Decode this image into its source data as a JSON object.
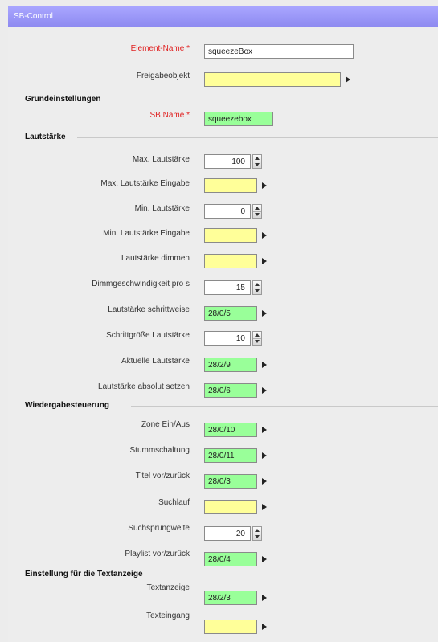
{
  "window": {
    "title": "SB-Control"
  },
  "general": {
    "element_name": {
      "label": "Element-Name",
      "required_mark": "*",
      "value": "squeezeBox"
    },
    "freigabeobjekt": {
      "label": "Freigabeobjekt",
      "value": ""
    }
  },
  "grundeinstellungen": {
    "title": "Grundeinstellungen",
    "sb_name": {
      "label": "SB Name",
      "required_mark": "*",
      "value": "squeezebox"
    }
  },
  "lautstaerke": {
    "title": "Lautstärke",
    "max": {
      "label": "Max. Lautstärke",
      "value": "100"
    },
    "max_input": {
      "label": "Max. Lautstärke Eingabe",
      "value": ""
    },
    "min": {
      "label": "Min. Lautstärke",
      "value": "0"
    },
    "min_input": {
      "label": "Min. Lautstärke Eingabe",
      "value": ""
    },
    "dimmen": {
      "label": "Lautstärke dimmen",
      "value": ""
    },
    "dimm_speed": {
      "label": "Dimmgeschwindigkeit pro s",
      "value": "15"
    },
    "schrittweise": {
      "label": "Lautstärke schrittweise",
      "value": "28/0/5"
    },
    "schrittgroesse": {
      "label": "Schrittgröße Lautstärke",
      "value": "10"
    },
    "aktuell": {
      "label": "Aktuelle Lautstärke",
      "value": "28/2/9"
    },
    "absolut": {
      "label": "Lautstärke absolut setzen",
      "value": "28/0/6"
    }
  },
  "wiedergabe": {
    "title": "Wiedergabesteuerung",
    "zone": {
      "label": "Zone Ein/Aus",
      "value": "28/0/10"
    },
    "stumm": {
      "label": "Stummschaltung",
      "value": "28/0/11"
    },
    "titel": {
      "label": "Titel vor/zurück",
      "value": "28/0/3"
    },
    "suchlauf": {
      "label": "Suchlauf",
      "value": ""
    },
    "suchsprung": {
      "label": "Suchsprungweite",
      "value": "20"
    },
    "playlist": {
      "label": "Playlist vor/zurück",
      "value": "28/0/4"
    }
  },
  "textanzeige": {
    "title": "Einstellung für die Textanzeige",
    "anzeige": {
      "label": "Textanzeige",
      "value": "28/2/3"
    },
    "eingang": {
      "label": "Texteingang",
      "value": ""
    }
  },
  "colors": {
    "title_bar": "#9a97f8",
    "required": "#e02020",
    "empty_field": "#ffff99",
    "bound_field": "#99ff99"
  },
  "icons": {
    "link": "arrow-right-icon",
    "spinner": "spinner-icon"
  }
}
